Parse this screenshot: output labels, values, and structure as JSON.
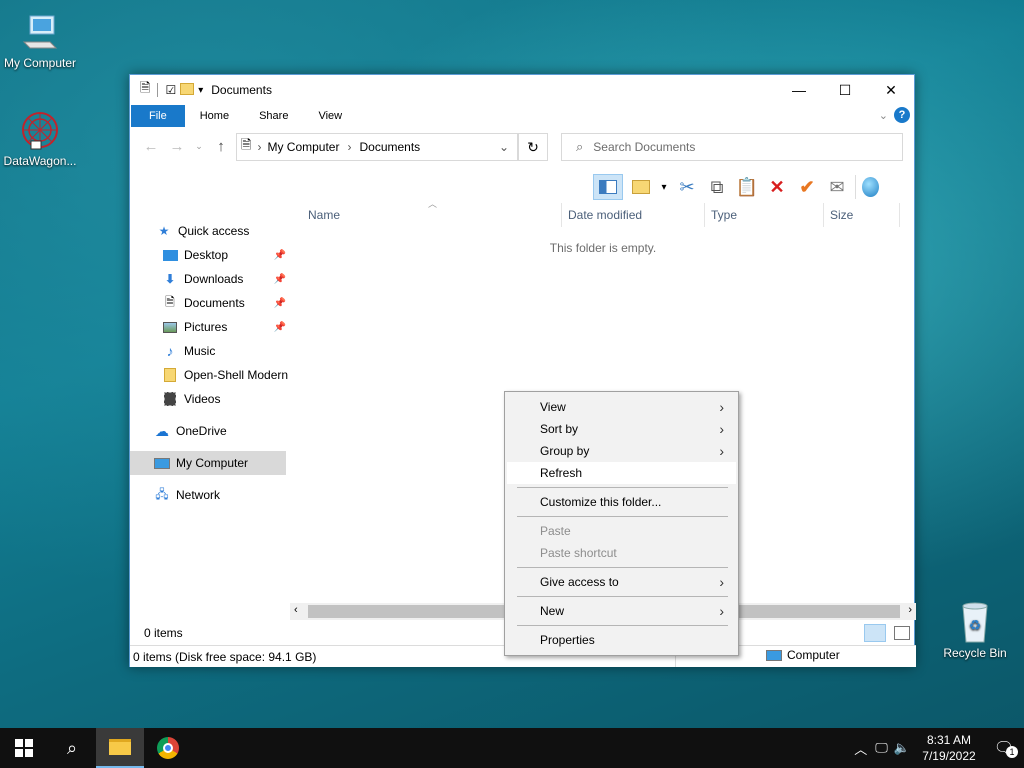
{
  "desktop": {
    "icons": [
      {
        "label": "My Computer"
      },
      {
        "label": "DataWagon..."
      },
      {
        "label": "Recycle Bin"
      }
    ]
  },
  "window": {
    "title": "Documents",
    "ribbon_tabs": [
      "File",
      "Home",
      "Share",
      "View"
    ],
    "address": {
      "segments": [
        "My Computer",
        "Documents"
      ]
    },
    "search_placeholder": "Search Documents",
    "columns": [
      "Name",
      "Date modified",
      "Type",
      "Size"
    ],
    "empty_message": "This folder is empty.",
    "nav": {
      "quick_access": "Quick access",
      "items": [
        "Desktop",
        "Downloads",
        "Documents",
        "Pictures",
        "Music",
        "Open-Shell Modern",
        "Videos"
      ],
      "onedrive": "OneDrive",
      "my_computer": "My Computer",
      "network": "Network"
    },
    "status": {
      "count": "0 items",
      "disk": "0 items (Disk free space: 94.1 GB)",
      "location": "Computer"
    }
  },
  "context_menu": {
    "view": "View",
    "sort_by": "Sort by",
    "group_by": "Group by",
    "refresh": "Refresh",
    "customize": "Customize this folder...",
    "paste": "Paste",
    "paste_shortcut": "Paste shortcut",
    "give_access": "Give access to",
    "new": "New",
    "properties": "Properties"
  },
  "taskbar": {
    "time": "8:31 AM",
    "date": "7/19/2022",
    "notification_count": "1"
  },
  "colors": {
    "accent": "#1979ca",
    "taskbar": "#101010"
  }
}
